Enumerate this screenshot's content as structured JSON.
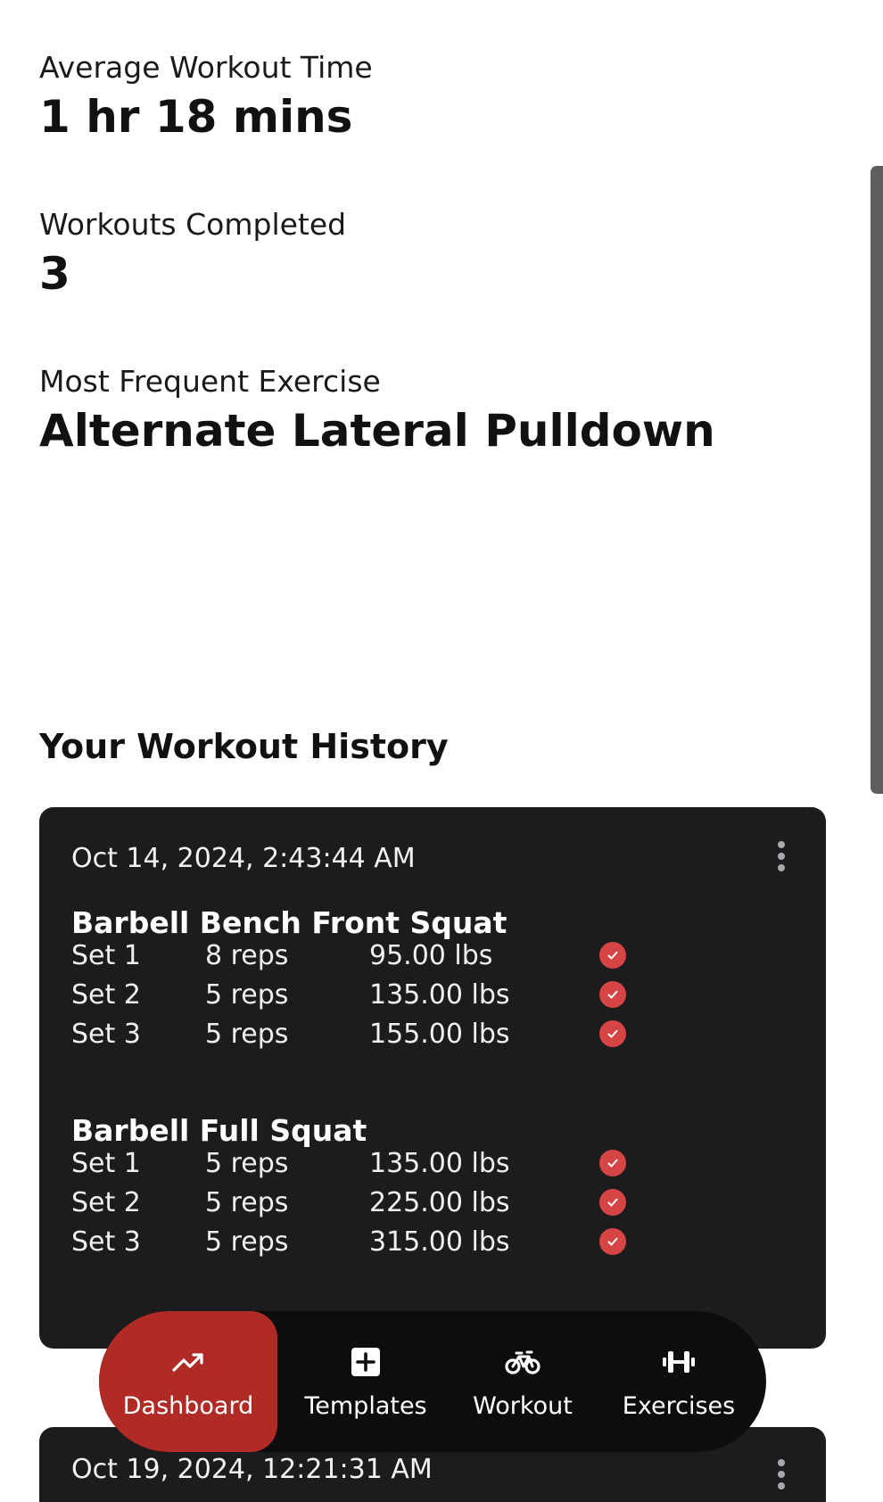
{
  "stats": {
    "avg_time": {
      "label": "Average Workout Time",
      "value": "1 hr 18 mins"
    },
    "completed": {
      "label": "Workouts Completed",
      "value": "3"
    },
    "frequent": {
      "label": "Most Frequent Exercise",
      "value": "Alternate Lateral Pulldown"
    }
  },
  "history": {
    "title": "Your Workout History",
    "workouts": [
      {
        "date": "Oct 14, 2024, 2:43:44 AM",
        "exercises": [
          {
            "name": "Barbell Bench Front Squat",
            "sets": [
              {
                "set": "Set 1",
                "reps": "8 reps",
                "weight": "95.00 lbs"
              },
              {
                "set": "Set 2",
                "reps": "5 reps",
                "weight": "135.00 lbs"
              },
              {
                "set": "Set 3",
                "reps": "5 reps",
                "weight": "155.00 lbs"
              }
            ]
          },
          {
            "name": "Barbell Full Squat",
            "sets": [
              {
                "set": "Set 1",
                "reps": "5 reps",
                "weight": "135.00 lbs"
              },
              {
                "set": "Set 2",
                "reps": "5 reps",
                "weight": "225.00 lbs"
              },
              {
                "set": "Set 3",
                "reps": "5 reps",
                "weight": "315.00 lbs"
              }
            ]
          }
        ]
      },
      {
        "date": "Oct 19, 2024, 12:21:31 AM"
      }
    ]
  },
  "nav": {
    "items": [
      {
        "label": "Dashboard",
        "icon": "trending-up-icon",
        "active": true
      },
      {
        "label": "Templates",
        "icon": "plus-square-icon",
        "active": false
      },
      {
        "label": "Workout",
        "icon": "bicycle-icon",
        "active": false
      },
      {
        "label": "Exercises",
        "icon": "dumbbell-icon",
        "active": false
      }
    ]
  },
  "colors": {
    "accent": "#b02a26",
    "check": "#d64545",
    "card_bg": "#1c1c1e",
    "nav_bg": "#0d0d0f"
  }
}
